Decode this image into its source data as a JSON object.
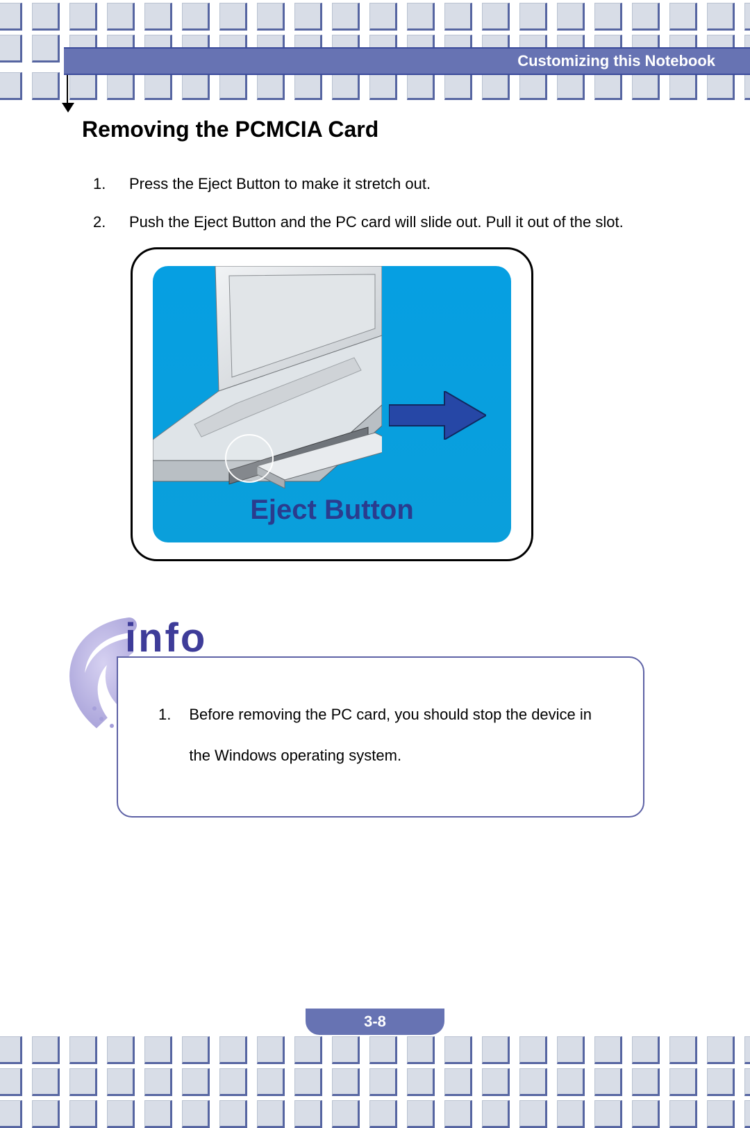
{
  "header": {
    "chapter_title": "Customizing  this  Notebook"
  },
  "section": {
    "title": "Removing the PCMCIA Card",
    "steps": [
      {
        "num": "1.",
        "text": "Press the Eject Button to make it stretch out."
      },
      {
        "num": "2.",
        "text": "Push the Eject Button and the PC card will slide out.    Pull it out of the slot."
      }
    ]
  },
  "figure": {
    "callout_label": "Eject Button"
  },
  "info": {
    "label": "info",
    "items": [
      {
        "num": "1.",
        "text": "Before removing the PC card, you should stop the device in the Windows operating system."
      }
    ]
  },
  "page_number": "3-8"
}
